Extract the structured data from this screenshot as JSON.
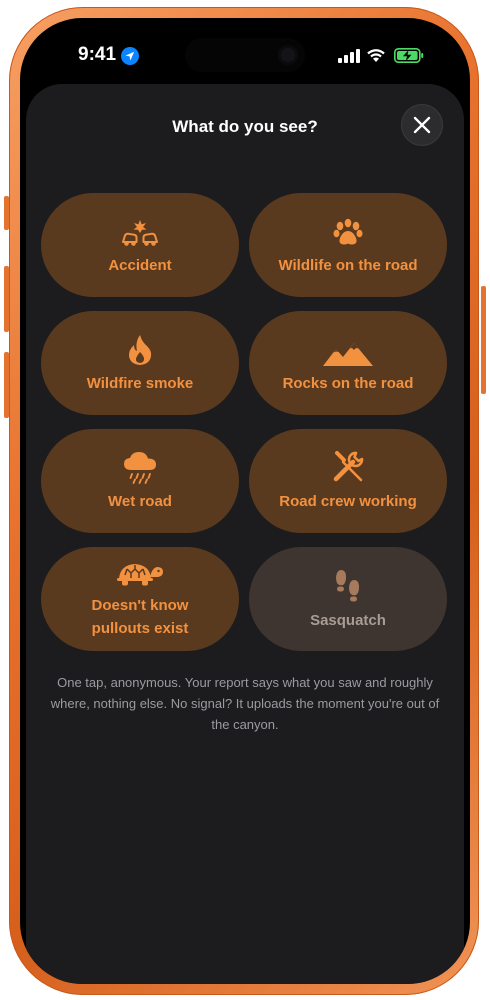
{
  "status_bar": {
    "time": "9:41",
    "location_icon": "location-arrow-icon",
    "signal_icon": "cellular-signal-icon",
    "wifi_icon": "wifi-icon",
    "battery_icon": "battery-charging-icon"
  },
  "sheet": {
    "title": "What do you see?",
    "close_icon": "close-icon"
  },
  "options": [
    {
      "label": "Accident",
      "icon": "car-crash-icon",
      "enabled": true
    },
    {
      "label": "Wildlife on the road",
      "icon": "paw-icon",
      "enabled": true
    },
    {
      "label": "Wildfire smoke",
      "icon": "fire-icon",
      "enabled": true
    },
    {
      "label": "Rocks on the road",
      "icon": "mountain-rocks-icon",
      "enabled": true
    },
    {
      "label": "Wet road",
      "icon": "rain-cloud-icon",
      "enabled": true
    },
    {
      "label": "Road crew working",
      "icon": "tools-icon",
      "enabled": true
    },
    {
      "label_line1": "Doesn't know",
      "label_line2": "pullouts exist",
      "icon": "turtle-icon",
      "enabled": true
    },
    {
      "label": "Sasquatch",
      "icon": "footprints-icon",
      "enabled": false
    }
  ],
  "footnote": "One tap, anonymous. Your report says what you saw and roughly where, nothing else. No signal? It uploads the moment you're out of the canyon.",
  "colors": {
    "accent": "#f2913f",
    "tile_background": "#5a3a1f",
    "tile_disabled_background": "#3e3430",
    "disabled_text": "#a99c94",
    "sheet_background": "#1c1c1e",
    "frame": "#e8732e",
    "battery_charging": "#4cd964",
    "location": "#0a84ff"
  }
}
